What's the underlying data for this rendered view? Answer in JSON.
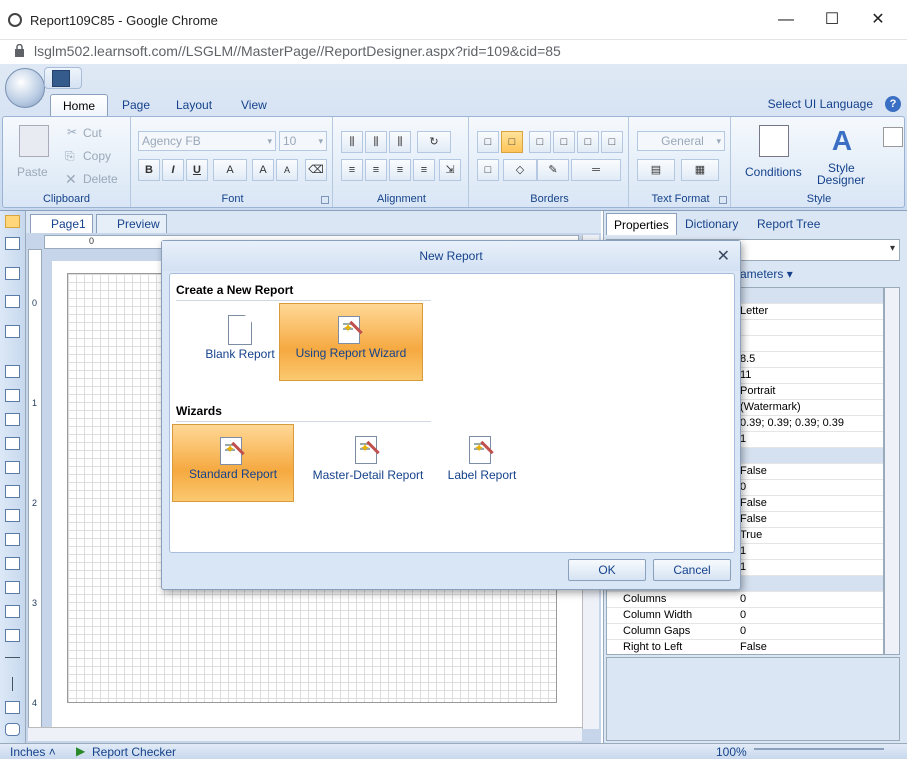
{
  "window": {
    "title": "Report109C85 - Google Chrome",
    "url": "lsglm502.learnsoft.com//LSGLM//MasterPage//ReportDesigner.aspx?rid=109&cid=85",
    "minimize": "—",
    "maximize": "☐",
    "close": "✕"
  },
  "ribbon": {
    "tabs": [
      "Home",
      "Page",
      "Layout",
      "View"
    ],
    "select_language": "Select UI Language",
    "help": "?",
    "clipboard": {
      "paste": "Paste",
      "cut": "Cut",
      "copy": "Copy",
      "delete": "Delete",
      "label": "Clipboard"
    },
    "font": {
      "family": "Agency FB",
      "size": "10",
      "label": "Font",
      "bold": "B",
      "italic": "I",
      "underline": "U",
      "color": "A",
      "grow": "A",
      "shrink": "A"
    },
    "alignment": {
      "label": "Alignment"
    },
    "borders": {
      "label": "Borders"
    },
    "text_format": {
      "value": "General",
      "label": "Text Format"
    },
    "style": {
      "conditions": "Conditions",
      "style_designer_1": "Style",
      "style_designer_2": "Designer",
      "label": "Style"
    }
  },
  "document": {
    "tabs": [
      "Page1",
      "Preview"
    ],
    "ruler_zero": "0",
    "vruler_marks": [
      "0",
      "1",
      "2",
      "3",
      "4"
    ]
  },
  "properties": {
    "tabs": [
      "Properties",
      "Dictionary",
      "Report Tree"
    ],
    "parameters": "ameters",
    "rows": [
      {
        "k": "",
        "v": "",
        "cat": true
      },
      {
        "k": "",
        "v": "Letter"
      },
      {
        "k": "",
        "v": ""
      },
      {
        "k": "",
        "v": ""
      },
      {
        "k": "",
        "v": "8.5"
      },
      {
        "k": "",
        "v": "11"
      },
      {
        "k": "",
        "v": "Portrait"
      },
      {
        "k": "",
        "v": "(Watermark)"
      },
      {
        "k": "",
        "v": "0.39; 0.39; 0.39; 0.39"
      },
      {
        "k": "",
        "v": "1"
      },
      {
        "k": "",
        "v": "",
        "cat": true
      },
      {
        "k": "",
        "v": "False"
      },
      {
        "k": "",
        "v": "0"
      },
      {
        "k": "",
        "v": "False"
      },
      {
        "k": "",
        "v": "False"
      },
      {
        "k": "",
        "v": "True"
      },
      {
        "k": "",
        "v": "1"
      },
      {
        "k": "",
        "v": "1"
      },
      {
        "k": "",
        "v": "",
        "cat": true
      },
      {
        "k": "Columns",
        "v": "0"
      },
      {
        "k": "Column Width",
        "v": "0"
      },
      {
        "k": "Column Gaps",
        "v": "0"
      },
      {
        "k": "Right to Left",
        "v": "False"
      }
    ]
  },
  "status": {
    "units": "Inches",
    "checker": "Report Checker",
    "zoom": "100%"
  },
  "dialog": {
    "title": "New Report",
    "close": "✕",
    "section_new": "Create a New Report",
    "blank": "Blank Report",
    "wizard": "Using Report Wizard",
    "section_wizards": "Wizards",
    "standard": "Standard Report",
    "master_detail": "Master-Detail Report",
    "label": "Label Report",
    "ok": "OK",
    "cancel": "Cancel"
  }
}
